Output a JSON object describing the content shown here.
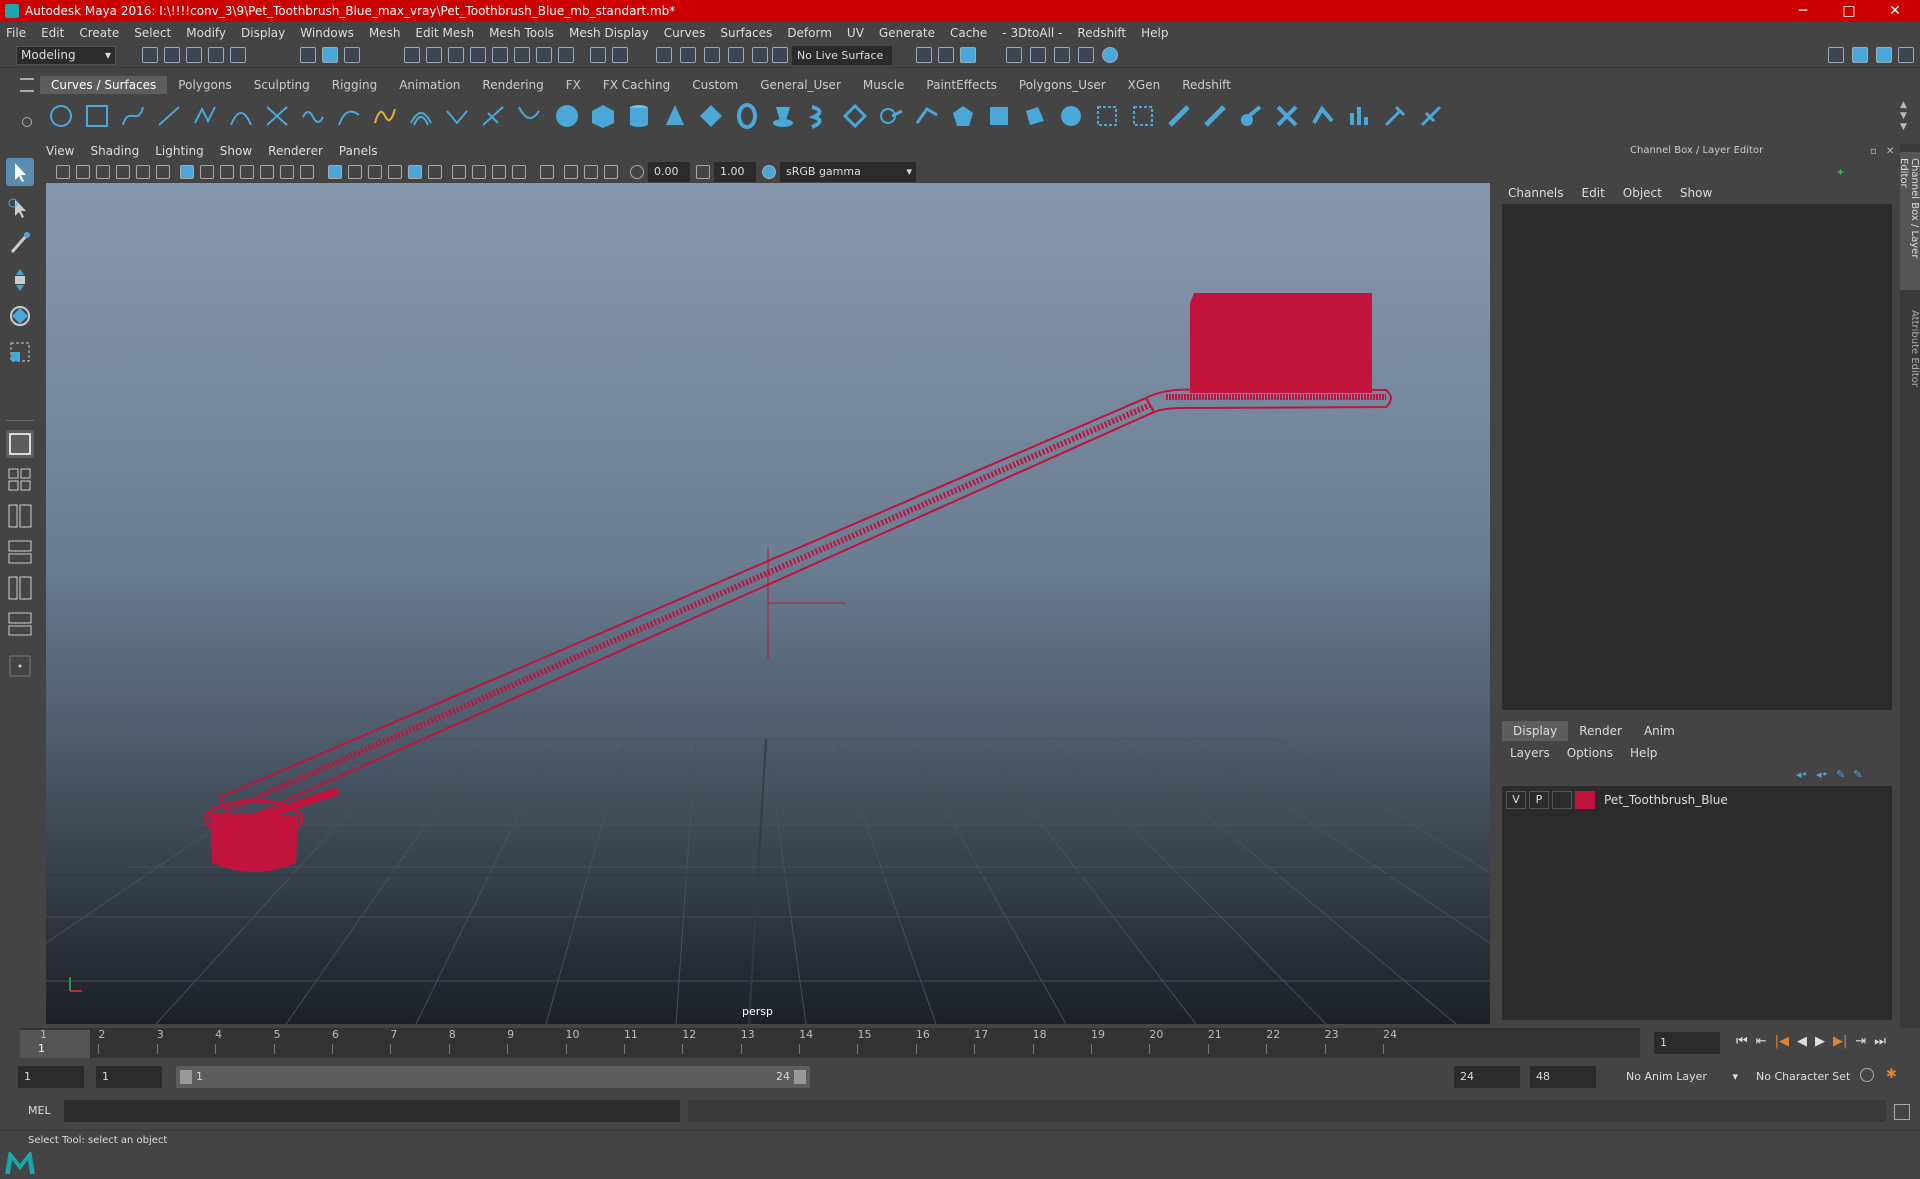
{
  "window": {
    "title": "Autodesk Maya 2016: I:\\!!!!conv_3\\9\\Pet_Toothbrush_Blue_max_vray\\Pet_Toothbrush_Blue_mb_standart.mb*",
    "minimize": "─",
    "maximize": "□",
    "close": "✕"
  },
  "menus": [
    "File",
    "Edit",
    "Create",
    "Select",
    "Modify",
    "Display",
    "Windows",
    "Mesh",
    "Edit Mesh",
    "Mesh Tools",
    "Mesh Display",
    "Curves",
    "Surfaces",
    "Deform",
    "UV",
    "Generate",
    "Cache",
    "- 3DtoAll -",
    "Redshift",
    "Help"
  ],
  "status": {
    "mode": "Modeling",
    "live_surface": "No Live Surface"
  },
  "shelf_tabs": [
    "Curves / Surfaces",
    "Polygons",
    "Sculpting",
    "Rigging",
    "Animation",
    "Rendering",
    "FX",
    "FX Caching",
    "Custom",
    "General_User",
    "Muscle",
    "PaintEffects",
    "Polygons_User",
    "XGen",
    "Redshift"
  ],
  "viewport": {
    "menus": [
      "View",
      "Shading",
      "Lighting",
      "Show",
      "Renderer",
      "Panels"
    ],
    "exposure": "0.00",
    "gamma": "1.00",
    "color_space": "sRGB gamma",
    "camera": "persp"
  },
  "channel_box": {
    "title": "Channel Box / Layer Editor",
    "menus": [
      "Channels",
      "Edit",
      "Object",
      "Show"
    ]
  },
  "layer_editor": {
    "tabs": [
      "Display",
      "Render",
      "Anim"
    ],
    "menus": [
      "Layers",
      "Options",
      "Help"
    ],
    "layer": {
      "v": "V",
      "p": "P",
      "name": "Pet_Toothbrush_Blue",
      "color": "#c0143c"
    }
  },
  "side_tabs": [
    "Channel Box / Layer Editor",
    "Attribute Editor"
  ],
  "timeline": {
    "ticks": [
      "1",
      "2",
      "3",
      "4",
      "5",
      "6",
      "7",
      "8",
      "9",
      "10",
      "11",
      "12",
      "13",
      "14",
      "15",
      "16",
      "17",
      "18",
      "19",
      "20",
      "21",
      "22",
      "23",
      "24"
    ],
    "current_frame": "1",
    "current_field": "1"
  },
  "range": {
    "start": "1",
    "playback_start": "1",
    "slider_start": "1",
    "slider_end": "24",
    "playback_end": "24",
    "end": "48",
    "anim_layer": "No Anim Layer",
    "character_set": "No Character Set"
  },
  "cmdline": {
    "label": "MEL"
  },
  "help": "Select Tool: select an object",
  "colors": {
    "title_bg": "#cc0000",
    "model": "#c0143c",
    "accent": "#4aa8d8"
  }
}
